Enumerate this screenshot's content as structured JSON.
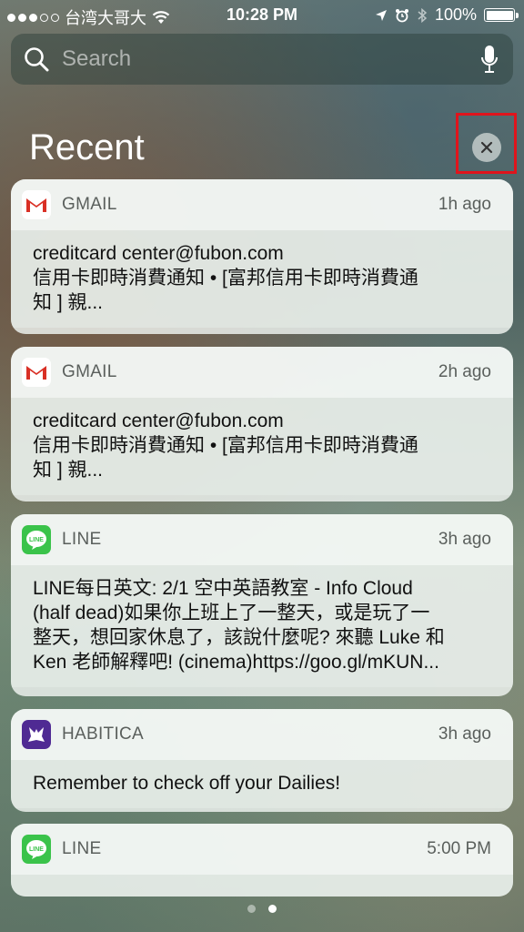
{
  "status_bar": {
    "carrier": "台湾大哥大",
    "time": "10:28 PM",
    "battery": "100%",
    "battery_level": 1.0
  },
  "search": {
    "placeholder": "Search"
  },
  "section": {
    "title": "Recent"
  },
  "notifications": [
    {
      "app": "GMAIL",
      "icon": "gmail-icon",
      "time": "1h ago",
      "lines": [
        "creditcard center@fubon.com",
        "信用卡即時消費通知 • [富邦信用卡即時消費通",
        "知 ] 親..."
      ]
    },
    {
      "app": "GMAIL",
      "icon": "gmail-icon",
      "time": "2h ago",
      "lines": [
        "creditcard center@fubon.com",
        "信用卡即時消費通知 • [富邦信用卡即時消費通",
        "知 ] 親..."
      ]
    },
    {
      "app": "LINE",
      "icon": "line-icon",
      "time": "3h ago",
      "lines": [
        "LINE每日英文: 2/1 空中英語教室 - Info Cloud",
        "(half dead)如果你上班上了一整天，或是玩了一",
        "整天，想回家休息了，該說什麼呢? 來聽 Luke 和",
        "Ken 老師解釋吧! (cinema)https://goo.gl/mKUN..."
      ]
    },
    {
      "app": "HABITICA",
      "icon": "habitica-icon",
      "time": "3h ago",
      "lines": [
        "Remember to check off your Dailies!"
      ]
    },
    {
      "app": "LINE",
      "icon": "line-icon",
      "time": "5:00 PM",
      "lines": []
    }
  ],
  "page_indicator": {
    "count": 2,
    "active": 2
  },
  "colors": {
    "highlight": "#e0141c",
    "line_green": "#3ac34a",
    "habitica_purple": "#4f2a93",
    "gmail_red": "#d93025"
  }
}
